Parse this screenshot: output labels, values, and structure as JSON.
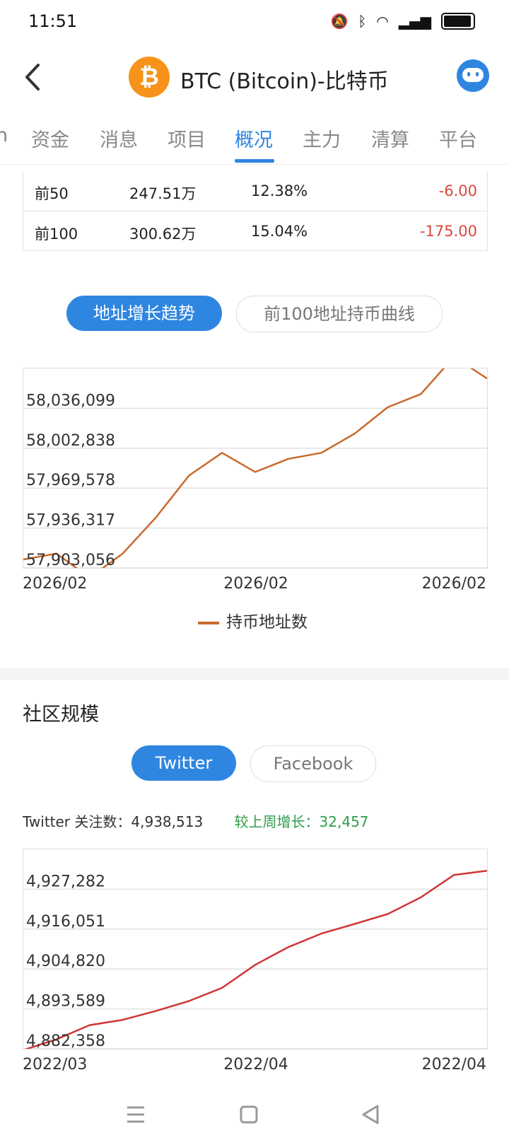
{
  "status": {
    "time": "11:51"
  },
  "header": {
    "title": "BTC (Bitcoin)-比特币",
    "logo_symbol": "₿"
  },
  "tabs": [
    {
      "label": "资金",
      "active": false
    },
    {
      "label": "消息",
      "active": false
    },
    {
      "label": "项目",
      "active": false
    },
    {
      "label": "概况",
      "active": true
    },
    {
      "label": "主力",
      "active": false
    },
    {
      "label": "清算",
      "active": false
    },
    {
      "label": "平台",
      "active": false
    }
  ],
  "holders_table": {
    "rows": [
      {
        "rank": "前50",
        "amount": "247.51万",
        "percent": "12.38%",
        "change": "-6.00"
      },
      {
        "rank": "前100",
        "amount": "300.62万",
        "percent": "15.04%",
        "change": "-175.00"
      }
    ]
  },
  "address_toggle": {
    "active": "地址增长趋势",
    "inactive": "前100地址持币曲线"
  },
  "community": {
    "title": "社区规模",
    "toggle": {
      "active": "Twitter",
      "inactive": "Facebook"
    },
    "followers_label": "Twitter 关注数：",
    "followers_value": "4,938,513",
    "growth_label": "较上周增长：",
    "growth_value": "32,457"
  },
  "chart_data": [
    {
      "type": "line",
      "series": [
        {
          "name": "持币地址数",
          "color": "#c9692c",
          "values": [
            57910000,
            57915000,
            57895000,
            57915000,
            57945000,
            57980000,
            57999000,
            57983000,
            57994000,
            57999000,
            58015000,
            58037000,
            58048000,
            58079000,
            58061000
          ]
        }
      ],
      "xlabels": [
        "2026/02",
        "2026/02",
        "2026/02"
      ],
      "ytick_labels": [
        "58,036,099",
        "58,002,838",
        "57,969,578",
        "57,936,317",
        "57,903,056"
      ],
      "yticks": [
        58036099,
        58002838,
        57969578,
        57936317,
        57903056
      ],
      "ylim": [
        57903056,
        58069360
      ],
      "grid": true
    },
    {
      "type": "line",
      "series": [
        {
          "color": "#d03535",
          "values": [
            4882000,
            4885000,
            4889000,
            4890500,
            4893000,
            4895800,
            4899500,
            4906000,
            4911000,
            4914800,
            4917500,
            4920300,
            4925000,
            4931300,
            4932500
          ]
        }
      ],
      "xlabels": [
        "2022/03",
        "2022/04",
        "2022/04"
      ],
      "ytick_labels": [
        "4,927,282",
        "4,916,051",
        "4,904,820",
        "4,893,589",
        "4,882,358"
      ],
      "yticks": [
        4927282,
        4916051,
        4904820,
        4893589,
        4882358
      ],
      "ylim": [
        4882358,
        4938513
      ],
      "grid": true
    }
  ]
}
